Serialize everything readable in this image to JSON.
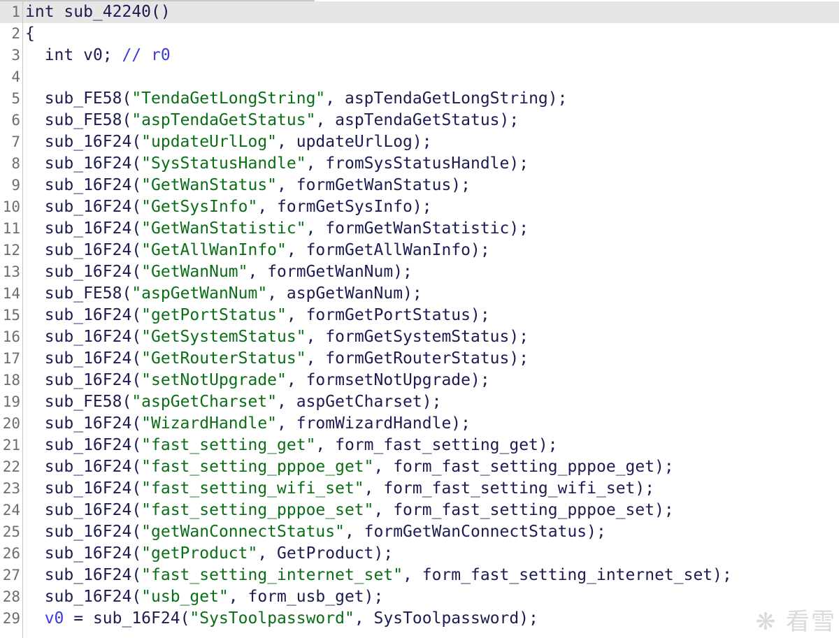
{
  "editor": {
    "watermark": "❋ 看雪",
    "lines": [
      {
        "n": "1",
        "parts": [
          {
            "t": "int sub_42240()",
            "k": "def"
          }
        ]
      },
      {
        "n": "2",
        "parts": [
          {
            "t": "{",
            "k": "def"
          }
        ]
      },
      {
        "n": "3",
        "parts": [
          {
            "t": "  int ",
            "k": "def"
          },
          {
            "t": "v0",
            "k": "def"
          },
          {
            "t": "; ",
            "k": "def"
          },
          {
            "t": "// r0",
            "k": "cmt"
          }
        ]
      },
      {
        "n": "4",
        "parts": []
      },
      {
        "n": "5",
        "parts": [
          {
            "t": "  sub_FE58(",
            "k": "def"
          },
          {
            "t": "\"TendaGetLongString\"",
            "k": "str"
          },
          {
            "t": ", aspTendaGetLongString);",
            "k": "def"
          }
        ]
      },
      {
        "n": "6",
        "parts": [
          {
            "t": "  sub_FE58(",
            "k": "def"
          },
          {
            "t": "\"aspTendaGetStatus\"",
            "k": "str"
          },
          {
            "t": ", aspTendaGetStatus);",
            "k": "def"
          }
        ]
      },
      {
        "n": "7",
        "parts": [
          {
            "t": "  sub_16F24(",
            "k": "def"
          },
          {
            "t": "\"updateUrlLog\"",
            "k": "str"
          },
          {
            "t": ", updateUrlLog);",
            "k": "def"
          }
        ]
      },
      {
        "n": "8",
        "parts": [
          {
            "t": "  sub_16F24(",
            "k": "def"
          },
          {
            "t": "\"SysStatusHandle\"",
            "k": "str"
          },
          {
            "t": ", fromSysStatusHandle);",
            "k": "def"
          }
        ]
      },
      {
        "n": "9",
        "parts": [
          {
            "t": "  sub_16F24(",
            "k": "def"
          },
          {
            "t": "\"GetWanStatus\"",
            "k": "str"
          },
          {
            "t": ", formGetWanStatus);",
            "k": "def"
          }
        ]
      },
      {
        "n": "10",
        "parts": [
          {
            "t": "  sub_16F24(",
            "k": "def"
          },
          {
            "t": "\"GetSysInfo\"",
            "k": "str"
          },
          {
            "t": ", formGetSysInfo);",
            "k": "def"
          }
        ]
      },
      {
        "n": "11",
        "parts": [
          {
            "t": "  sub_16F24(",
            "k": "def"
          },
          {
            "t": "\"GetWanStatistic\"",
            "k": "str"
          },
          {
            "t": ", formGetWanStatistic);",
            "k": "def"
          }
        ]
      },
      {
        "n": "12",
        "parts": [
          {
            "t": "  sub_16F24(",
            "k": "def"
          },
          {
            "t": "\"GetAllWanInfo\"",
            "k": "str"
          },
          {
            "t": ", formGetAllWanInfo);",
            "k": "def"
          }
        ]
      },
      {
        "n": "13",
        "parts": [
          {
            "t": "  sub_16F24(",
            "k": "def"
          },
          {
            "t": "\"GetWanNum\"",
            "k": "str"
          },
          {
            "t": ", formGetWanNum);",
            "k": "def"
          }
        ]
      },
      {
        "n": "14",
        "parts": [
          {
            "t": "  sub_FE58(",
            "k": "def"
          },
          {
            "t": "\"aspGetWanNum\"",
            "k": "str"
          },
          {
            "t": ", aspGetWanNum);",
            "k": "def"
          }
        ]
      },
      {
        "n": "15",
        "parts": [
          {
            "t": "  sub_16F24(",
            "k": "def"
          },
          {
            "t": "\"getPortStatus\"",
            "k": "str"
          },
          {
            "t": ", formGetPortStatus);",
            "k": "def"
          }
        ]
      },
      {
        "n": "16",
        "parts": [
          {
            "t": "  sub_16F24(",
            "k": "def"
          },
          {
            "t": "\"GetSystemStatus\"",
            "k": "str"
          },
          {
            "t": ", formGetSystemStatus);",
            "k": "def"
          }
        ]
      },
      {
        "n": "17",
        "parts": [
          {
            "t": "  sub_16F24(",
            "k": "def"
          },
          {
            "t": "\"GetRouterStatus\"",
            "k": "str"
          },
          {
            "t": ", formGetRouterStatus);",
            "k": "def"
          }
        ]
      },
      {
        "n": "18",
        "parts": [
          {
            "t": "  sub_16F24(",
            "k": "def"
          },
          {
            "t": "\"setNotUpgrade\"",
            "k": "str"
          },
          {
            "t": ", formsetNotUpgrade);",
            "k": "def"
          }
        ]
      },
      {
        "n": "19",
        "parts": [
          {
            "t": "  sub_FE58(",
            "k": "def"
          },
          {
            "t": "\"aspGetCharset\"",
            "k": "str"
          },
          {
            "t": ", aspGetCharset);",
            "k": "def"
          }
        ]
      },
      {
        "n": "20",
        "parts": [
          {
            "t": "  sub_16F24(",
            "k": "def"
          },
          {
            "t": "\"WizardHandle\"",
            "k": "str"
          },
          {
            "t": ", fromWizardHandle);",
            "k": "def"
          }
        ]
      },
      {
        "n": "21",
        "parts": [
          {
            "t": "  sub_16F24(",
            "k": "def"
          },
          {
            "t": "\"fast_setting_get\"",
            "k": "str"
          },
          {
            "t": ", form_fast_setting_get);",
            "k": "def"
          }
        ]
      },
      {
        "n": "22",
        "parts": [
          {
            "t": "  sub_16F24(",
            "k": "def"
          },
          {
            "t": "\"fast_setting_pppoe_get\"",
            "k": "str"
          },
          {
            "t": ", form_fast_setting_pppoe_get);",
            "k": "def"
          }
        ]
      },
      {
        "n": "23",
        "parts": [
          {
            "t": "  sub_16F24(",
            "k": "def"
          },
          {
            "t": "\"fast_setting_wifi_set\"",
            "k": "str"
          },
          {
            "t": ", form_fast_setting_wifi_set);",
            "k": "def"
          }
        ]
      },
      {
        "n": "24",
        "parts": [
          {
            "t": "  sub_16F24(",
            "k": "def"
          },
          {
            "t": "\"fast_setting_pppoe_set\"",
            "k": "str"
          },
          {
            "t": ", form_fast_setting_pppoe_set);",
            "k": "def"
          }
        ]
      },
      {
        "n": "25",
        "parts": [
          {
            "t": "  sub_16F24(",
            "k": "def"
          },
          {
            "t": "\"getWanConnectStatus\"",
            "k": "str"
          },
          {
            "t": ", formGetWanConnectStatus);",
            "k": "def"
          }
        ]
      },
      {
        "n": "26",
        "parts": [
          {
            "t": "  sub_16F24(",
            "k": "def"
          },
          {
            "t": "\"getProduct\"",
            "k": "str"
          },
          {
            "t": ", GetProduct);",
            "k": "def"
          }
        ]
      },
      {
        "n": "27",
        "parts": [
          {
            "t": "  sub_16F24(",
            "k": "def"
          },
          {
            "t": "\"fast_setting_internet_set\"",
            "k": "str"
          },
          {
            "t": ", form_fast_setting_internet_set);",
            "k": "def"
          }
        ]
      },
      {
        "n": "28",
        "parts": [
          {
            "t": "  sub_16F24(",
            "k": "def"
          },
          {
            "t": "\"usb_get\"",
            "k": "str"
          },
          {
            "t": ", form_usb_get);",
            "k": "def"
          }
        ]
      },
      {
        "n": "29",
        "parts": [
          {
            "t": "  ",
            "k": "def"
          },
          {
            "t": "v0",
            "k": "var"
          },
          {
            "t": " = sub_16F24(",
            "k": "def"
          },
          {
            "t": "\"SysToolpassword\"",
            "k": "str"
          },
          {
            "t": ", SysToolpassword);",
            "k": "def"
          }
        ]
      }
    ]
  },
  "colors": {
    "default": "#1c1c52",
    "string": "#0a6e16",
    "variable": "#3a3ae0",
    "comment": "#3a3ae0",
    "line_number": "#6d6d6d",
    "current_line": "#e6e6e6"
  }
}
